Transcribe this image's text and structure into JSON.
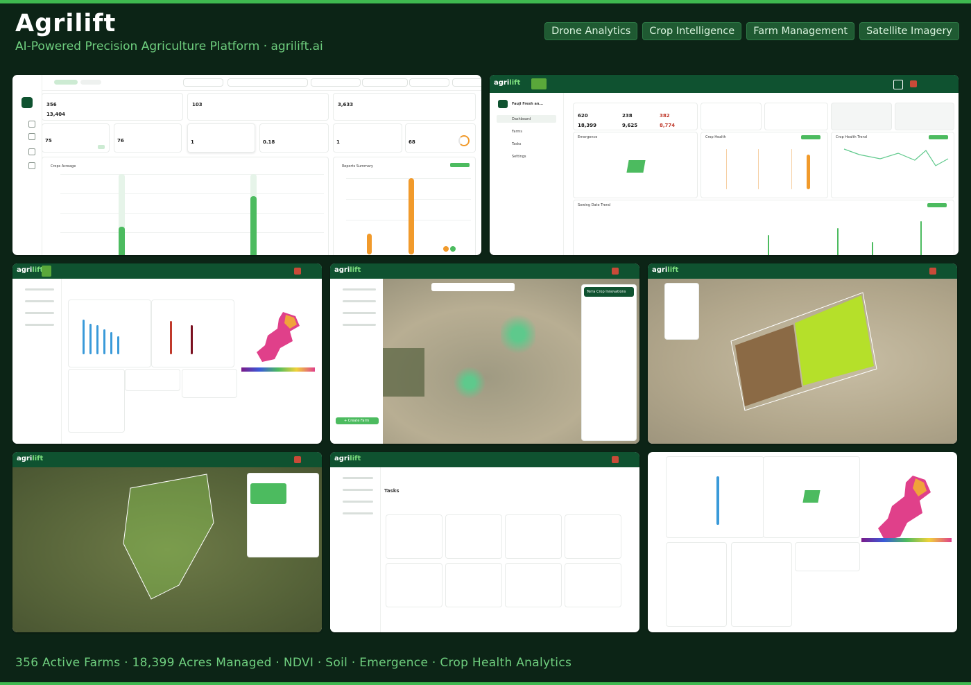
{
  "header": {
    "title": "Agrilift",
    "subtitle": "AI-Powered Precision Agriculture Platform  ·  agrilift.ai",
    "tags": [
      "Drone Analytics",
      "Crop Intelligence",
      "Farm Management",
      "Satellite Imagery"
    ]
  },
  "footer": {
    "text": "356 Active Farms  ·  18,399 Acres Managed  ·  NDVI · Soil · Emergence · Crop Health Analytics"
  },
  "screens": {
    "s1": {
      "total_farms": "356",
      "total_farm_area": "13,404",
      "total_flights": "103",
      "acres_flown": "3,633",
      "farms_visited": "75",
      "total_visits": "76",
      "flight_recency": "1",
      "processing_time": "0.18",
      "turnaround_time": "1",
      "emergence": "68",
      "chart_title": "Crops Acreage",
      "report_title": "Reports Summary"
    },
    "s2": {
      "farm": "Fauji Fresh an...",
      "total_farms": "620",
      "total_farm_area": "18,399",
      "stat_a": "238",
      "stat_b": "9,625",
      "stat_c": "382",
      "stat_d": "8,774",
      "crop_health": "Crop Health",
      "crop_health_trend": "Crop Health Trend",
      "emergence": "Emergence",
      "sowing_trend": "Sowing Date Trend",
      "nav": [
        "Dashboard",
        "Farms",
        "Tasks",
        "Settings"
      ]
    },
    "s4": {
      "panel_title": "Terra Crop Innovations",
      "create_btn": "+ Create Farm"
    },
    "s8": {
      "tasks_title": "Tasks"
    }
  }
}
